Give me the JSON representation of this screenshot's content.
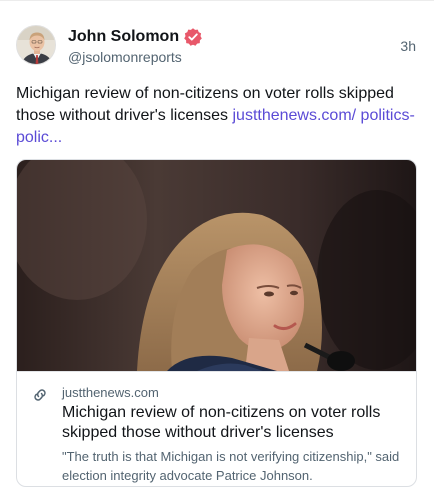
{
  "author": {
    "display_name": "John Solomon",
    "handle": "@jsolomonreports",
    "verified_icon": "verified-badge-icon",
    "verified_color": "#e8586a"
  },
  "post": {
    "timestamp": "3h",
    "text": "Michigan review of non-citizens on voter rolls skipped those without driver's licenses ",
    "link_text": "justthenews.com/ politics-polic...",
    "link_color": "#5b4bd6"
  },
  "link_card": {
    "icon": "link-icon",
    "domain": "justthenews.com",
    "title": "Michigan review of non-citizens on voter rolls skipped those without driver's licenses",
    "description": "\"The truth is that Michigan is not verifying citizenship,\" said election integrity advocate Patrice Johnson."
  }
}
